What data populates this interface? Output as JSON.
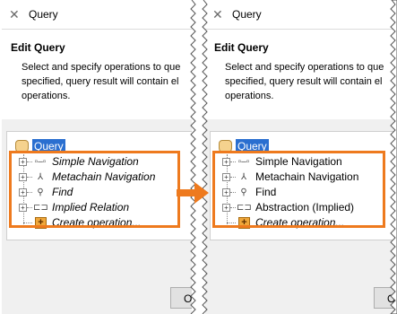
{
  "colors": {
    "highlight": "#ee7a1e",
    "selection": "#2a6fd0",
    "arrow": "#ee7a1e"
  },
  "before": {
    "window_title": "Query",
    "banner_title": "Edit Query",
    "banner_desc_line1": "Select and specify operations to que",
    "banner_desc_line2": "specified, query result will contain el",
    "banner_desc_line3": "operations.",
    "root_label": "Query",
    "items": [
      {
        "label": "Simple Navigation",
        "icon": "simple-navigation-icon",
        "italic": true
      },
      {
        "label": "Metachain Navigation",
        "icon": "metachain-navigation-icon",
        "italic": true
      },
      {
        "label": "Find",
        "icon": "find-icon",
        "italic": true
      },
      {
        "label": "Implied Relation",
        "icon": "implied-relation-icon",
        "italic": true
      },
      {
        "label": "Create operation...",
        "icon": "create-operation-icon",
        "italic": true
      }
    ],
    "ok_label": "O"
  },
  "after": {
    "window_title": "Query",
    "banner_title": "Edit Query",
    "banner_desc_line1": "Select and specify operations to que",
    "banner_desc_line2": "specified, query result will contain el",
    "banner_desc_line3": "operations.",
    "root_label": "Query",
    "items": [
      {
        "label": "Simple Navigation",
        "icon": "simple-navigation-icon",
        "italic": false
      },
      {
        "label": "Metachain Navigation",
        "icon": "metachain-navigation-icon",
        "italic": false
      },
      {
        "label": "Find",
        "icon": "find-icon",
        "italic": false
      },
      {
        "label": "Abstraction (Implied)",
        "icon": "abstraction-icon",
        "italic": false
      },
      {
        "label": "Create operation...",
        "icon": "create-operation-icon",
        "italic": true
      }
    ],
    "ok_label": "O"
  }
}
